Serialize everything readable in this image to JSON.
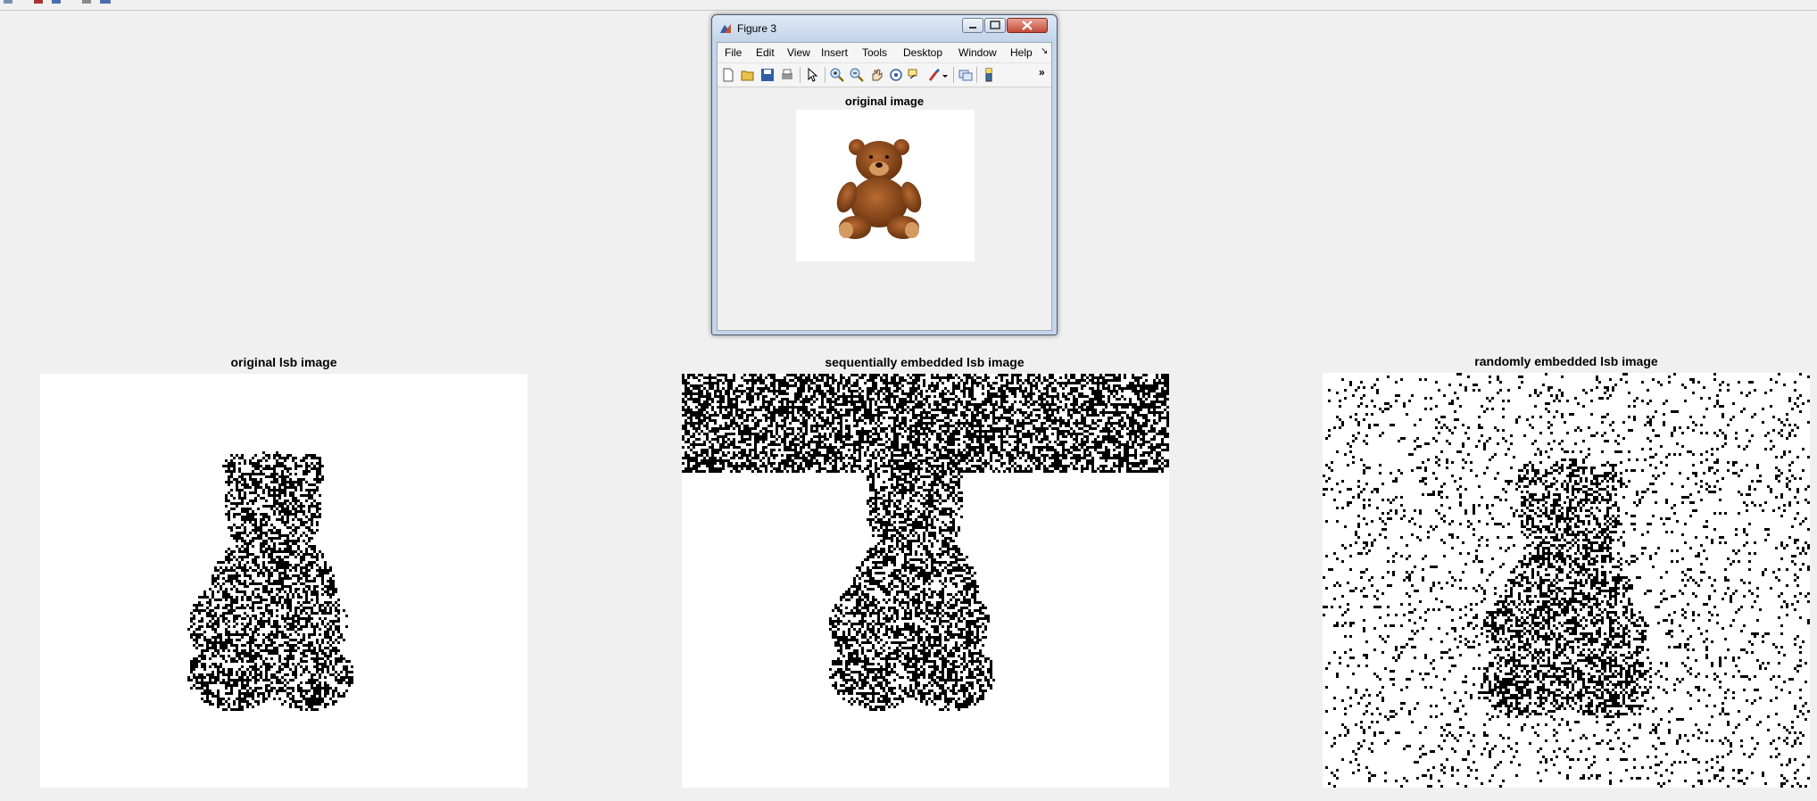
{
  "figure_window": {
    "title": "Figure 3",
    "menu": [
      "File",
      "Edit",
      "View",
      "Insert",
      "Tools",
      "Desktop",
      "Window",
      "Help"
    ],
    "menu_overflow": "↘",
    "toolbar_overflow": "»",
    "axes_title": "original image"
  },
  "panels": [
    {
      "title": "original lsb image"
    },
    {
      "title": "sequentially embedded lsb image"
    },
    {
      "title": "randomly embedded lsb image"
    }
  ],
  "colors": {
    "background": "#f0f0f0",
    "bear_brown": "#8b4a1c",
    "noise": "#000000"
  },
  "icons": [
    "new-figure-icon",
    "open-file-icon",
    "save-icon",
    "print-icon",
    "pointer-icon",
    "zoom-in-icon",
    "zoom-out-icon",
    "pan-icon",
    "rotate-3d-icon",
    "data-cursor-icon",
    "brush-icon",
    "link-plot-icon",
    "colorbar-icon"
  ]
}
